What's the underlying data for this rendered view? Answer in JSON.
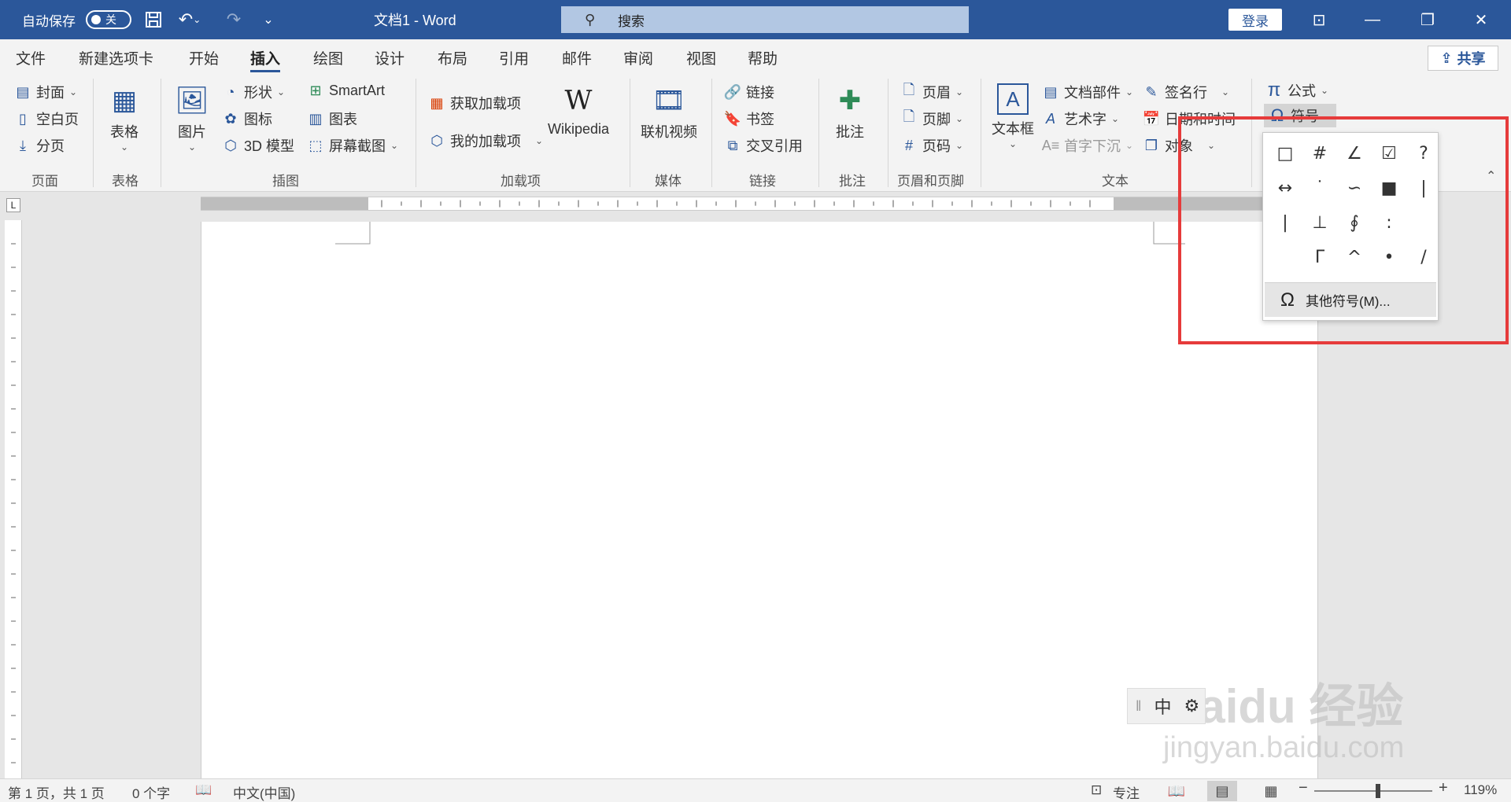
{
  "titlebar": {
    "autosave_label": "自动保存",
    "autosave_state": "关",
    "doc_title": "文档1  -  Word",
    "search_placeholder": "搜索",
    "login_label": "登录"
  },
  "tabs": [
    {
      "label": "文件"
    },
    {
      "label": "新建选项卡"
    },
    {
      "label": "开始"
    },
    {
      "label": "插入",
      "active": true
    },
    {
      "label": "绘图"
    },
    {
      "label": "设计"
    },
    {
      "label": "布局"
    },
    {
      "label": "引用"
    },
    {
      "label": "邮件"
    },
    {
      "label": "审阅"
    },
    {
      "label": "视图"
    },
    {
      "label": "帮助"
    }
  ],
  "share_label": "共享",
  "ribbon": {
    "pages": {
      "cover": "封面",
      "blank": "空白页",
      "break": "分页",
      "group": "页面"
    },
    "tables": {
      "table": "表格",
      "group": "表格"
    },
    "illustrations": {
      "picture": "图片",
      "shapes": "形状",
      "icons": "图标",
      "model3d": "3D 模型",
      "smartart": "SmartArt",
      "chart": "图表",
      "screenshot": "屏幕截图",
      "group": "插图"
    },
    "addins": {
      "get": "获取加载项",
      "mine": "我的加载项",
      "wikipedia": "Wikipedia",
      "group": "加载项"
    },
    "media": {
      "video": "联机视频",
      "group": "媒体"
    },
    "links": {
      "link": "链接",
      "bookmark": "书签",
      "crossref": "交叉引用",
      "group": "链接"
    },
    "comments": {
      "comment": "批注",
      "group": "批注"
    },
    "header_footer": {
      "header": "页眉",
      "footer": "页脚",
      "page_number": "页码",
      "group": "页眉和页脚"
    },
    "text": {
      "textbox": "文本框",
      "parts": "文档部件",
      "wordart": "艺术字",
      "dropcap": "首字下沉",
      "signature": "签名行",
      "datetime": "日期和时间",
      "object": "对象",
      "group": "文本"
    },
    "symbols": {
      "equation": "公式",
      "symbol": "符号"
    }
  },
  "symbol_menu": {
    "symbols": [
      "□",
      "#",
      "∠",
      "☑",
      "?",
      "↔",
      "˙",
      "∽",
      "■",
      "|",
      "|",
      "⊥",
      "∮",
      ":",
      "",
      "Γ",
      "^",
      "•",
      "/"
    ],
    "more_label": "其他符号(M)..."
  },
  "ime": {
    "mode": "中"
  },
  "watermark": {
    "main": "Baidu 经验",
    "sub": "jingyan.baidu.com"
  },
  "status": {
    "page": "第 1 页，共 1 页",
    "words": "0 个字",
    "language": "中文(中国)",
    "focus": "专注",
    "zoom": "119%"
  }
}
